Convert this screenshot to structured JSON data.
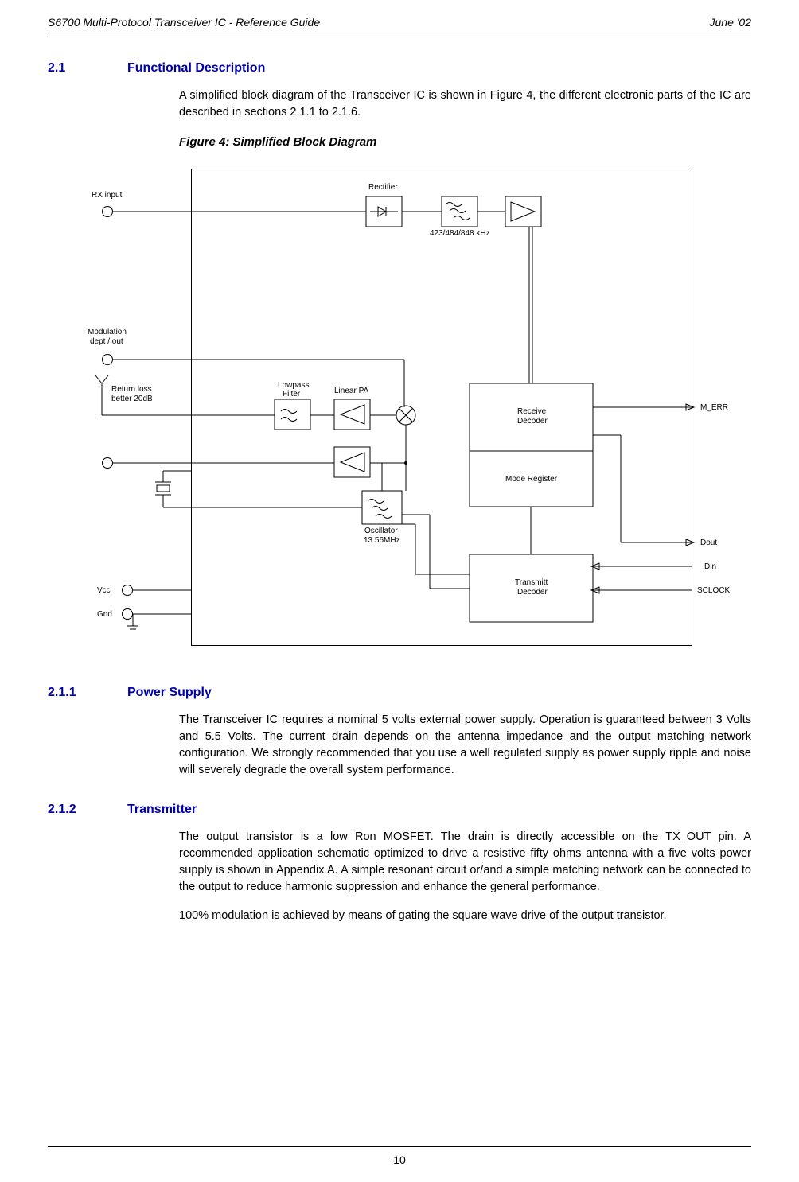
{
  "header": {
    "left": "S6700 Multi-Protocol Transceiver IC - Reference Guide",
    "right": "June '02"
  },
  "sections": [
    {
      "number": "2.1",
      "title": "Functional Description",
      "paragraphs": [
        "A simplified block diagram of the Transceiver IC is shown in Figure 4, the different electronic parts of the IC are described in sections 2.1.1 to 2.1.6."
      ]
    },
    {
      "number": "2.1.1",
      "title": "Power Supply",
      "paragraphs": [
        "The Transceiver IC requires a nominal 5 volts external power supply. Operation is guaranteed between 3 Volts and 5.5 Volts. The current drain depends on the antenna impedance and the output matching network configuration. We strongly recommended that you use a well regulated supply as power supply ripple and noise will severely degrade the overall system performance."
      ]
    },
    {
      "number": "2.1.2",
      "title": "Transmitter",
      "paragraphs": [
        "The output transistor is a low Ron MOSFET. The drain is directly accessible on the TX_OUT pin. A recommended application schematic optimized to drive a resistive fifty ohms antenna with a five volts power supply is shown in Appendix A. A simple resonant circuit or/and a simple matching network can be connected to the output to reduce harmonic suppression and enhance the general performance.",
        "100% modulation is achieved by means of gating the square wave drive of the output transistor."
      ]
    }
  ],
  "figure_caption": "Figure 4: Simplified Block Diagram",
  "diagram": {
    "rx_input": "RX input",
    "rectifier": "Rectifier",
    "freq": "423/484/848 kHz",
    "modulation1": "Modulation",
    "modulation2": "dept / out",
    "return_loss1": "Return loss",
    "return_loss2": "better 20dB",
    "lowpass1": "Lowpass",
    "lowpass2": "Filter",
    "linear_pa": "Linear PA",
    "receive1": "Receive",
    "receive2": "Decoder",
    "mode_register": "Mode Register",
    "transmit1": "Transmitt",
    "transmit2": "Decoder",
    "oscillator1": "Oscillator",
    "oscillator2": "13.56MHz",
    "vcc": "Vcc",
    "gnd": "Gnd",
    "m_err": "M_ERR",
    "dout": "Dout",
    "din": "Din",
    "sclock": "SCLOCK"
  },
  "page_number": "10"
}
